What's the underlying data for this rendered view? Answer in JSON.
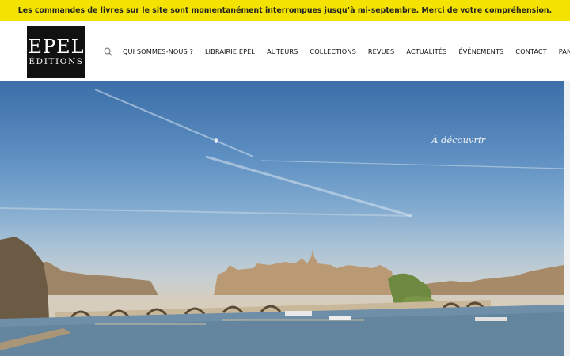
{
  "notice": {
    "text": "Les commandes de livres sur le site sont momentanément interrompues jusqu’à mi-septembre. Merci de votre compréhension.",
    "background": "#f4e300"
  },
  "logo": {
    "main": "EPEL",
    "sub": "ÉDITIONS"
  },
  "nav": {
    "search_icon": "search-icon",
    "items": [
      {
        "label": "QUI SOMMES-NOUS ?"
      },
      {
        "label": "LIBRAIRIE EPEL"
      },
      {
        "label": "AUTEURS"
      },
      {
        "label": "COLLECTIONS"
      },
      {
        "label": "REVUES"
      },
      {
        "label": "ACTUALITÉS"
      },
      {
        "label": "ÉVÉNEMENTS"
      },
      {
        "label": "CONTACT"
      },
      {
        "label": "PANIER"
      }
    ]
  },
  "hero": {
    "caption": "À découvrir"
  }
}
